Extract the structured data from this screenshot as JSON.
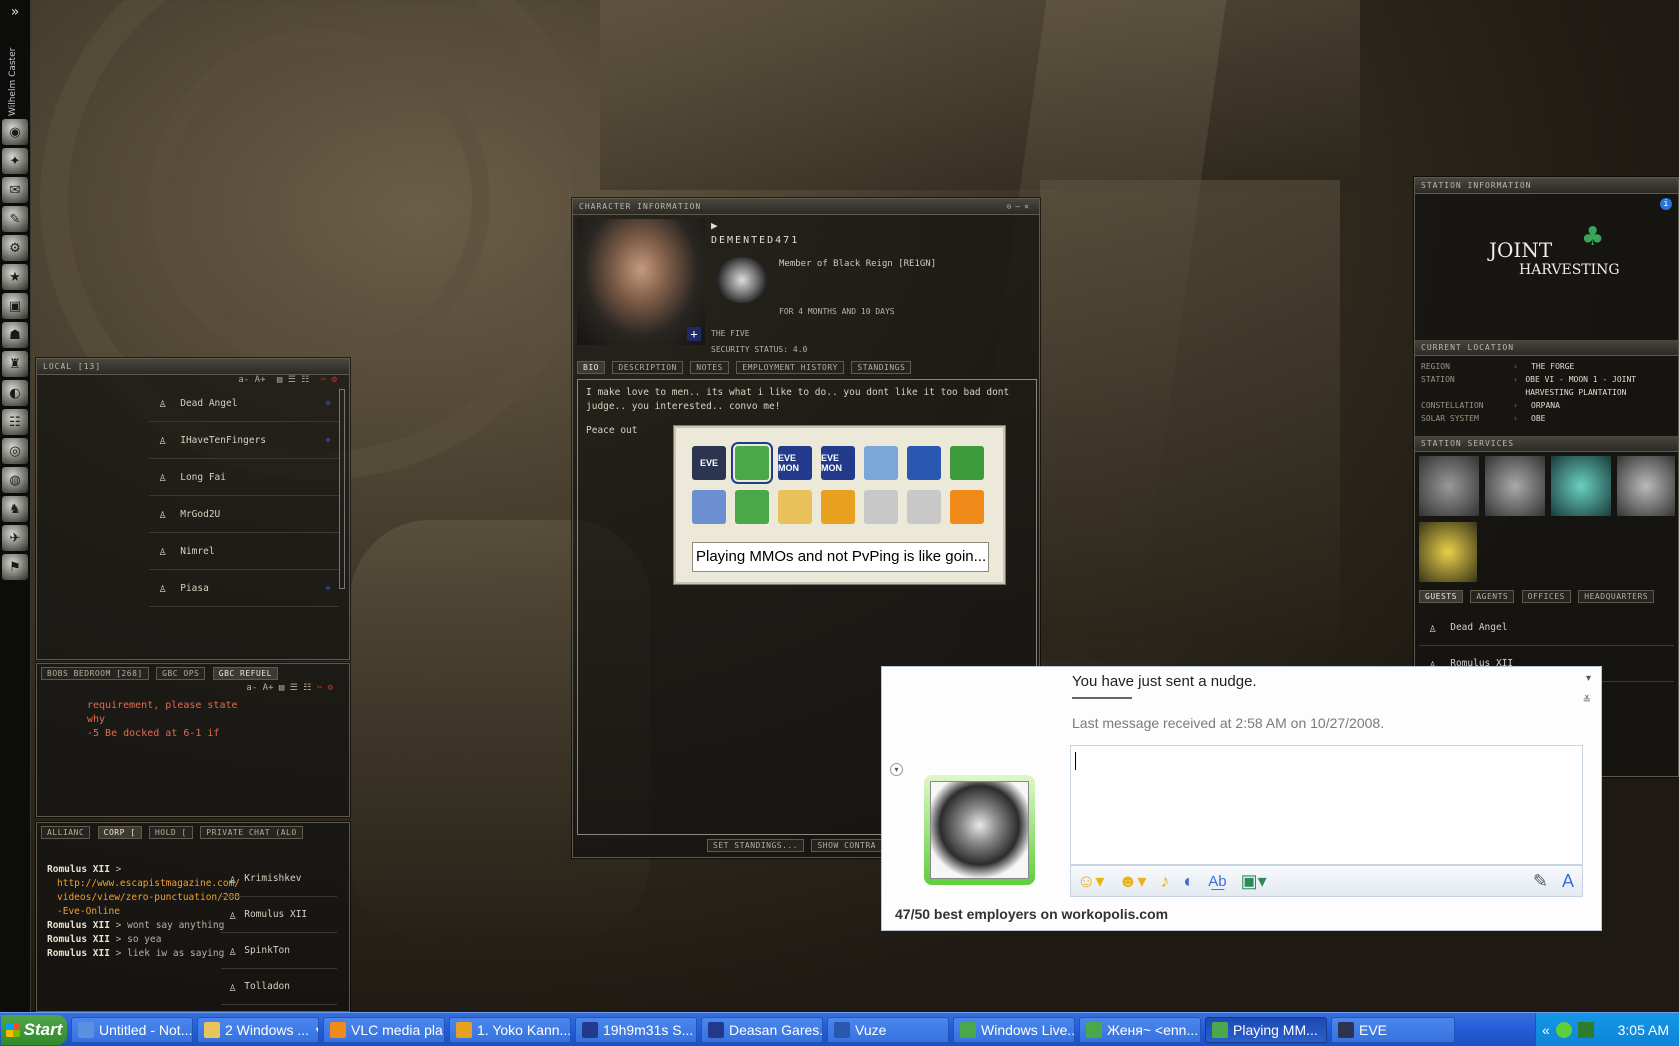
{
  "neocom": {
    "collapse_label": "»",
    "pilot_name": "Wilhelm Caster",
    "buttons": [
      "◉",
      "✦",
      "✉",
      "✎",
      "⚙",
      "★",
      "▣",
      "☗",
      "♜",
      "◐",
      "☷",
      "◎",
      "◍",
      "♞",
      "✈",
      "⚑"
    ]
  },
  "local_chat": {
    "title": "LOCAL [13]",
    "font_controls": "a- A+",
    "members": [
      "Dead Angel",
      "IHaveTenFingers",
      "Long Fai",
      "MrGod2U",
      "Nimrel",
      "Piasa"
    ]
  },
  "refuel_chat": {
    "tabs": [
      "BOBS BEDROOM [268]",
      "GBC OPS",
      "GBC REFUEL"
    ],
    "font_controls": "a- A+",
    "lines": [
      "requirement, please state",
      "why",
      "-5 Be docked at 6-1 if"
    ]
  },
  "corp_chat": {
    "tabs": [
      "ALLIANC",
      "CORP [",
      "HOLD [",
      "PRIVATE CHAT (ALO"
    ],
    "messages": [
      {
        "speaker": "Romulus XII",
        "text": ">",
        "link": "http://www.escapistmagazine.com/videos/view/zero-punctuation/208-Eve-Online"
      },
      {
        "speaker": "Romulus XII",
        "text": "> wont say anything"
      },
      {
        "speaker": "Romulus XII",
        "text": "> so yea"
      },
      {
        "speaker": "Romulus XII",
        "text": "> liek iw as saying"
      }
    ],
    "members": [
      "Krimishkev",
      "Romulus XII",
      "SpinkTon",
      "Tolladon"
    ]
  },
  "character_info": {
    "title": "CHARACTER INFORMATION",
    "name": "DEMENTED471",
    "membership": "Member of Black Reign [RE1GN]",
    "duration": "FOR 4 MONTHS AND 10 DAYS",
    "corp_line": "THE FIVE",
    "security_status": "SECURITY STATUS: 4.0",
    "tabs": [
      "BIO",
      "DESCRIPTION",
      "NOTES",
      "EMPLOYMENT HISTORY",
      "STANDINGS"
    ],
    "bio_line1": "I make love to men.. its what i like to do.. you dont like it too bad dont judge.. you interested.. convo me!",
    "bio_line2": "Peace out",
    "button_set_standings": "SET STANDINGS...",
    "button_show_contracts": "SHOW CONTRA"
  },
  "alt_tab": {
    "selected_title": "Playing MMOs and not PvPing is like goin...",
    "icons": [
      {
        "name": "eve",
        "label": "EVE",
        "color": "#2b3550"
      },
      {
        "name": "msn",
        "label": "",
        "color": "#4aa84a"
      },
      {
        "name": "evemon1",
        "label": "EVE MON",
        "color": "#233a8c"
      },
      {
        "name": "evemon2",
        "label": "EVE MON",
        "color": "#233a8c"
      },
      {
        "name": "my-computer",
        "label": "",
        "color": "#7aa6d8"
      },
      {
        "name": "vuze",
        "label": "",
        "color": "#2a58b0"
      },
      {
        "name": "msn-contacts",
        "label": "",
        "color": "#3d9b3d"
      },
      {
        "name": "notepad",
        "label": "",
        "color": "#6b8fd0"
      },
      {
        "name": "msn2",
        "label": "",
        "color": "#4aa84a"
      },
      {
        "name": "folder",
        "label": "",
        "color": "#e8c15a"
      },
      {
        "name": "winamp",
        "label": "",
        "color": "#e8a020"
      },
      {
        "name": "cd1",
        "label": "",
        "color": "#c8c8c8"
      },
      {
        "name": "cd2",
        "label": "",
        "color": "#c8c8c8"
      },
      {
        "name": "vlc",
        "label": "",
        "color": "#f08a18"
      }
    ]
  },
  "station_info": {
    "title": "STATION INFORMATION",
    "logo_line1": "JOINT",
    "logo_line2": "HARVESTING",
    "current_location_header": "CURRENT LOCATION",
    "rows": [
      {
        "label": "REGION",
        "value": "THE FORGE"
      },
      {
        "label": "STATION",
        "value": "OBE VI - MOON 1 - JOINT HARVESTING PLANTATION"
      },
      {
        "label": "CONSTELLATION",
        "value": "ORPANA"
      },
      {
        "label": "SOLAR SYSTEM",
        "value": "OBE"
      }
    ],
    "services_header": "STATION SERVICES",
    "tabs": [
      "GUESTS",
      "AGENTS",
      "OFFICES",
      "HEADQUARTERS"
    ],
    "guests": [
      "Dead Angel",
      "Romulus XII"
    ]
  },
  "messenger": {
    "nudge_text": "You have just sent a nudge.",
    "last_message": "Last message received at 2:58 AM on 10/27/2008.",
    "status_text": "47/50 best employers on workopolis.com",
    "toolbar_icons": [
      "emoticon-icon",
      "wink-icon",
      "voice-clip-icon",
      "nudge-icon",
      "font-icon",
      "background-icon",
      "pen-icon",
      "text-format-icon"
    ]
  },
  "taskbar": {
    "start_label": "Start",
    "tasks": [
      {
        "label": "Untitled - Not...",
        "color": "#5b8fe0"
      },
      {
        "label": "2 Windows ...",
        "color": "#e9c35c",
        "dropdown": true
      },
      {
        "label": "VLC media pla...",
        "color": "#f08a18"
      },
      {
        "label": "1. Yoko Kann...",
        "color": "#e8a020"
      },
      {
        "label": "19h9m31s S...",
        "color": "#233a8c"
      },
      {
        "label": "Deasan Gares...",
        "color": "#233a8c"
      },
      {
        "label": "Vuze",
        "color": "#2a58b0"
      },
      {
        "label": "Windows Live...",
        "color": "#4aa84a"
      },
      {
        "label": "Женя~ <enn...",
        "color": "#4aa84a"
      },
      {
        "label": "Playing MM...",
        "color": "#4aa84a",
        "active": true
      },
      {
        "label": "EVE",
        "color": "#2b3550"
      }
    ],
    "tray_chevron": "«",
    "clock": "3:05 AM"
  }
}
